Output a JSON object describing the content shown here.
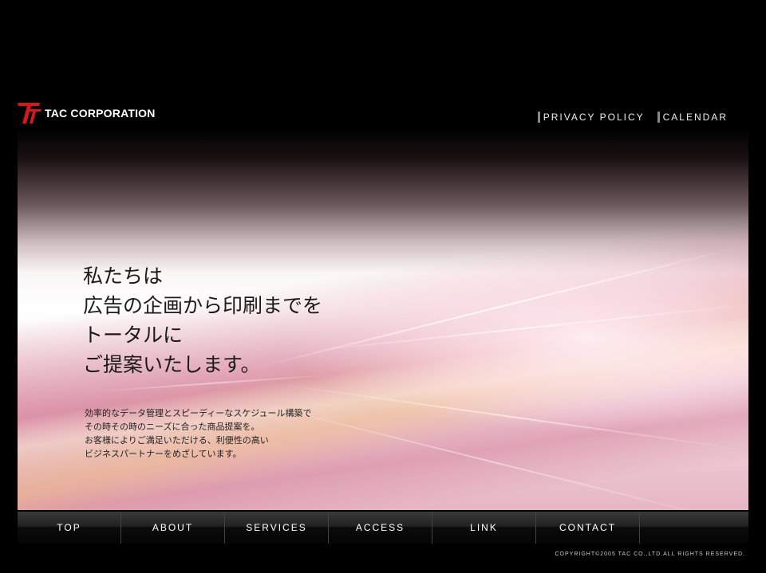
{
  "brand": {
    "name": "TAC CORPORATION",
    "logo_color": "#d6171e"
  },
  "header_links": [
    {
      "label": "Privacy policy"
    },
    {
      "label": "Calendar"
    }
  ],
  "hero": {
    "headline": [
      "私たちは",
      "広告の企画から印刷までを",
      "トータルに",
      "ご提案いたします。"
    ],
    "body": [
      "効率的なデータ管理とスピーディーなスケジュール構築で",
      "その時その時のニーズに合った商品提案を。",
      "お客様によりご満足いただける、利便性の高い",
      "ビジネスパートナーをめざしています。"
    ]
  },
  "nav": [
    {
      "label": "Top"
    },
    {
      "label": "About"
    },
    {
      "label": "Services"
    },
    {
      "label": "Access"
    },
    {
      "label": "Link"
    },
    {
      "label": "Contact"
    }
  ],
  "footer": {
    "copyright": "Copyright©2005 TAC Co.,Ltd.All Rights Reserved."
  }
}
